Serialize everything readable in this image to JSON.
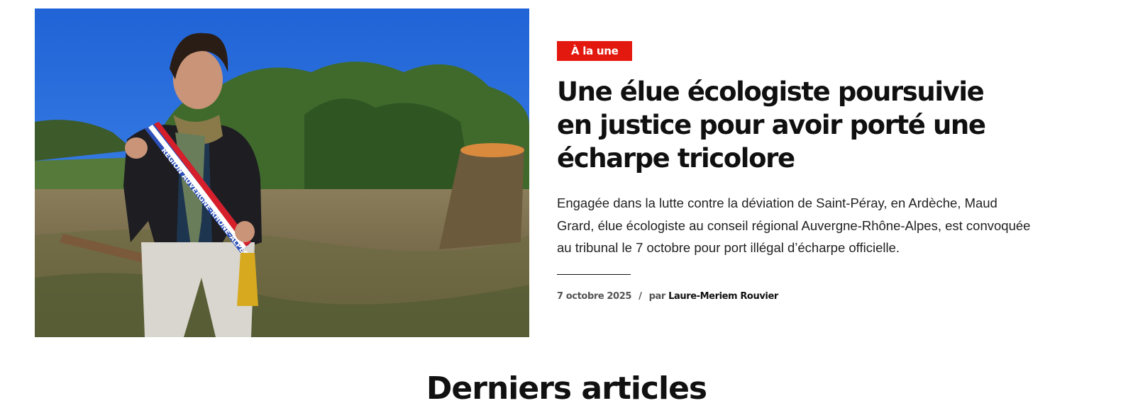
{
  "article": {
    "badge": "À la une",
    "title": "Une élue écologiste poursuivie en justice pour avoir porté une écharpe tricolore",
    "excerpt": "Engagée dans la lutte contre la déviation de Saint-Péray, en Ardèche, Maud Grard, élue écologiste au conseil régional Auvergne-Rhône-Alpes, est convoquée au tribunal le 7 octobre pour port illégal d’écharpe officielle.",
    "date": "7 octobre 2025",
    "separator": "/",
    "by_label": "par",
    "author": "Laure-Meriem Rouvier",
    "photo": {
      "sash_text": "RÉGION AUVERGNE-RHÔNE-ALPES",
      "description_icon": "photo-woman-sash"
    }
  },
  "next_section": {
    "heading": "Derniers articles"
  },
  "colors": {
    "badge_bg": "#e3180f",
    "title": "#101010",
    "sky": "#2b6fd6"
  }
}
